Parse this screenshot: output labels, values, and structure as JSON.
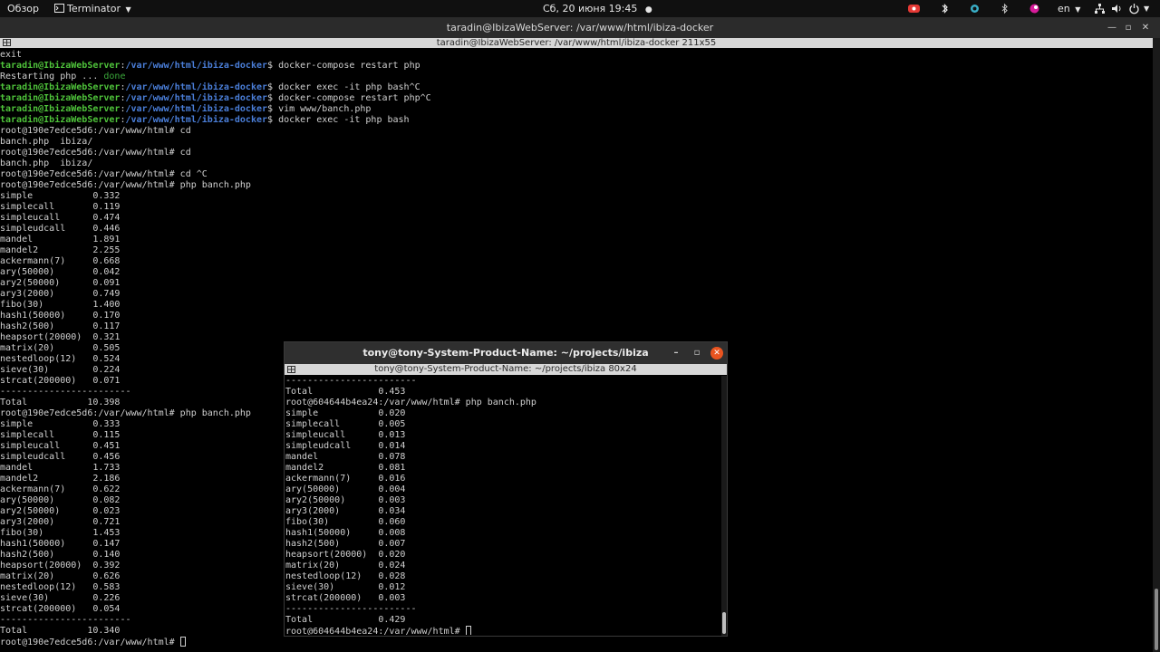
{
  "topbar": {
    "activities": "Обзор",
    "app_name": "Terminator",
    "datetime": "Сб, 20 июня  19:45",
    "language": "en"
  },
  "main_window": {
    "title": "taradin@IbizaWebServer: /var/www/html/ibiza-docker",
    "tab_title": "taradin@IbizaWebServer: /var/www/html/ibiza-docker 211x55",
    "lines": [
      {
        "text": "exit"
      },
      {
        "user": "taradin@IbizaWebServer",
        "path": "/var/www/html/ibiza-docker",
        "cmd": "docker-compose restart php"
      },
      {
        "text": "Restarting php ... ",
        "done": "done"
      },
      {
        "user": "taradin@IbizaWebServer",
        "path": "/var/www/html/ibiza-docker",
        "cmd": "docker exec -it php bash^C"
      },
      {
        "user": "taradin@IbizaWebServer",
        "path": "/var/www/html/ibiza-docker",
        "cmd": "docker-compose restart php^C"
      },
      {
        "user": "taradin@IbizaWebServer",
        "path": "/var/www/html/ibiza-docker",
        "cmd": "vim www/banch.php"
      },
      {
        "user": "taradin@IbizaWebServer",
        "path": "/var/www/html/ibiza-docker",
        "cmd": "docker exec -it php bash"
      },
      {
        "text": "root@190e7edce5d6:/var/www/html# cd"
      },
      {
        "text": "banch.php  ibiza/"
      },
      {
        "text": "root@190e7edce5d6:/var/www/html# cd"
      },
      {
        "text": "banch.php  ibiza/"
      },
      {
        "text": "root@190e7edce5d6:/var/www/html# cd ^C"
      },
      {
        "text": "root@190e7edce5d6:/var/www/html# php banch.php"
      },
      {
        "text": "simple           0.332"
      },
      {
        "text": "simplecall       0.119"
      },
      {
        "text": "simpleucall      0.474"
      },
      {
        "text": "simpleudcall     0.446"
      },
      {
        "text": "mandel           1.891"
      },
      {
        "text": "mandel2          2.255"
      },
      {
        "text": "ackermann(7)     0.668"
      },
      {
        "text": "ary(50000)       0.042"
      },
      {
        "text": "ary2(50000)      0.091"
      },
      {
        "text": "ary3(2000)       0.749"
      },
      {
        "text": "fibo(30)         1.400"
      },
      {
        "text": "hash1(50000)     0.170"
      },
      {
        "text": "hash2(500)       0.117"
      },
      {
        "text": "heapsort(20000)  0.321"
      },
      {
        "text": "matrix(20)       0.505"
      },
      {
        "text": "nestedloop(12)   0.524"
      },
      {
        "text": "sieve(30)        0.224"
      },
      {
        "text": "strcat(200000)   0.071"
      },
      {
        "text": "------------------------"
      },
      {
        "text": "Total           10.398"
      },
      {
        "text": "root@190e7edce5d6:/var/www/html# php banch.php"
      },
      {
        "text": "simple           0.333"
      },
      {
        "text": "simplecall       0.115"
      },
      {
        "text": "simpleucall      0.451"
      },
      {
        "text": "simpleudcall     0.456"
      },
      {
        "text": "mandel           1.733"
      },
      {
        "text": "mandel2          2.186"
      },
      {
        "text": "ackermann(7)     0.622"
      },
      {
        "text": "ary(50000)       0.082"
      },
      {
        "text": "ary2(50000)      0.023"
      },
      {
        "text": "ary3(2000)       0.721"
      },
      {
        "text": "fibo(30)         1.453"
      },
      {
        "text": "hash1(50000)     0.147"
      },
      {
        "text": "hash2(500)       0.140"
      },
      {
        "text": "heapsort(20000)  0.392"
      },
      {
        "text": "matrix(20)       0.626"
      },
      {
        "text": "nestedloop(12)   0.583"
      },
      {
        "text": "sieve(30)        0.226"
      },
      {
        "text": "strcat(200000)   0.054"
      },
      {
        "text": "------------------------"
      },
      {
        "text": "Total           10.340"
      },
      {
        "text": "root@190e7edce5d6:/var/www/html# ",
        "cursor": true
      }
    ]
  },
  "small_window": {
    "title": "tony@tony-System-Product-Name: ~/projects/ibiza",
    "tab_title": "tony@tony-System-Product-Name: ~/projects/ibiza 80x24",
    "lines": [
      {
        "text": "------------------------"
      },
      {
        "text": "Total            0.453"
      },
      {
        "text": "root@604644b4ea24:/var/www/html# php banch.php"
      },
      {
        "text": "simple           0.020"
      },
      {
        "text": "simplecall       0.005"
      },
      {
        "text": "simpleucall      0.013"
      },
      {
        "text": "simpleudcall     0.014"
      },
      {
        "text": "mandel           0.078"
      },
      {
        "text": "mandel2          0.081"
      },
      {
        "text": "ackermann(7)     0.016"
      },
      {
        "text": "ary(50000)       0.004"
      },
      {
        "text": "ary2(50000)      0.003"
      },
      {
        "text": "ary3(2000)       0.034"
      },
      {
        "text": "fibo(30)         0.060"
      },
      {
        "text": "hash1(50000)     0.008"
      },
      {
        "text": "hash2(500)       0.007"
      },
      {
        "text": "heapsort(20000)  0.020"
      },
      {
        "text": "matrix(20)       0.024"
      },
      {
        "text": "nestedloop(12)   0.028"
      },
      {
        "text": "sieve(30)        0.012"
      },
      {
        "text": "strcat(200000)   0.003"
      },
      {
        "text": "------------------------"
      },
      {
        "text": "Total            0.429"
      },
      {
        "text": "root@604644b4ea24:/var/www/html# ",
        "cursor": true
      }
    ]
  },
  "colors": {
    "prompt_user": "#4ec23a",
    "prompt_path": "#4a7ed8",
    "terminal_text": "#d0d0d0",
    "close_button": "#e95420"
  }
}
